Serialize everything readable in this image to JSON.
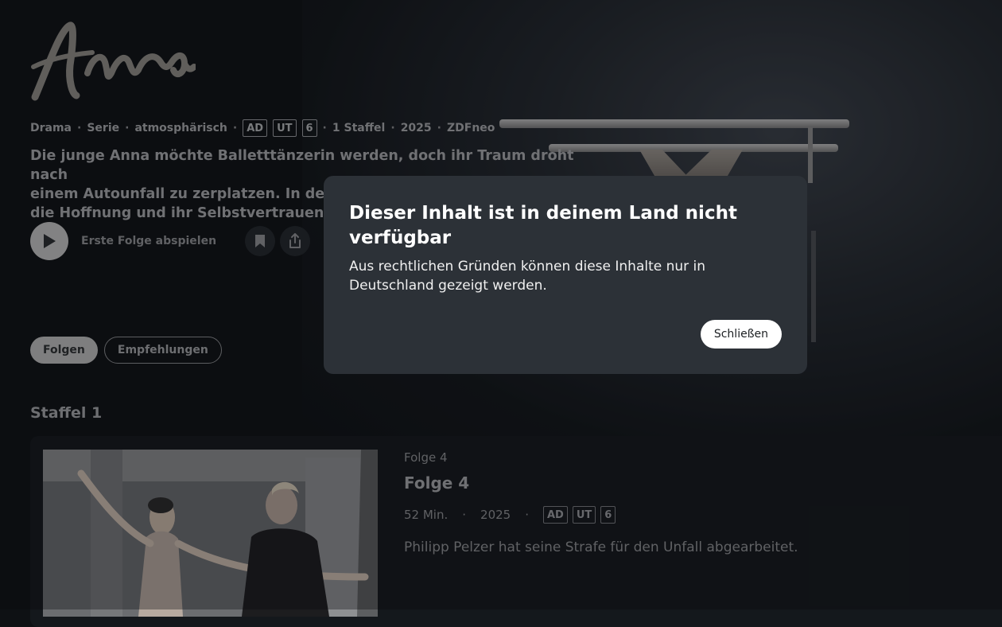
{
  "show": {
    "logo_text": "Anna",
    "meta": {
      "genre": "Drama",
      "type": "Serie",
      "mood": "atmosphärisch",
      "badges": [
        "AD",
        "UT",
        "6"
      ],
      "seasons": "1 Staffel",
      "year": "2025",
      "channel": "ZDFneo"
    },
    "description_lines": [
      "Die junge Anna möchte Balletttänzerin werden, doch ihr Traum droht nach",
      "einem Autounfall zu zerplatzen. In der Klinik hilft ihr der forsche Rainer",
      "die Hoffnung und ihr Selbstvertrauen w"
    ],
    "play_label": "Erste Folge abspielen",
    "icons": [
      "play-icon",
      "bookmark-icon",
      "share-icon"
    ]
  },
  "tabs": [
    {
      "label": "Folgen",
      "active": true
    },
    {
      "label": "Empfehlungen",
      "active": false
    }
  ],
  "season_title": "Staffel 1",
  "episode": {
    "subtitle": "Folge 4",
    "title": "Folge 4",
    "duration": "52 Min.",
    "year": "2025",
    "badges": [
      "AD",
      "UT",
      "6"
    ],
    "description": "Philipp Pelzer hat seine Strafe für den Unfall abgearbeitet."
  },
  "modal": {
    "title": "Dieser Inhalt ist in deinem Land nicht verfügbar",
    "text": "Aus rechtlichen Gründen können diese Inhalte nur in Deutschland gezeigt werden.",
    "close_label": "Schließen"
  }
}
